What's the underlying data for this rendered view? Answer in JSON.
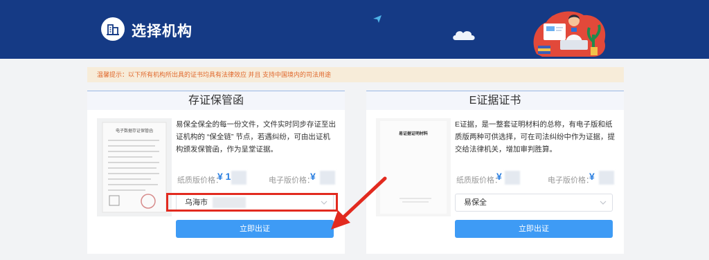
{
  "header": {
    "title": "选择机构",
    "logo_icon": "building-icon"
  },
  "notice": {
    "text": "温馨提示：以下所有机构所出具的证书均具有法律效应 并且 支持中国境内的司法用途"
  },
  "cards": [
    {
      "title": "存证保管函",
      "description": "易保全保全的每一份文件，文件实时同步存证至出证机构的 “保全链” 节点，若遇纠纷，可由出证机构颁发保管函，作为呈堂证据。",
      "image_caption": "电子数据存证保管函",
      "paper_price_label": "纸质版价格：",
      "paper_price_value": "¥ 1",
      "digital_price_label": "电子版价格：",
      "digital_price_value": "¥",
      "select_value": "乌海市",
      "button_label": "立即出证"
    },
    {
      "title": "E证据证书",
      "description": "E证据，是一整套证明材料的总称，有电子版和纸质版两种可供选择，可在司法纠纷中作为证据，提交给法律机关，增加审判胜算。",
      "image_caption": "易证据证明材料",
      "paper_price_label": "纸质版价格：",
      "paper_price_value": "¥",
      "digital_price_label": "电子版价格：",
      "digital_price_value": "¥",
      "select_value": "易保全",
      "button_label": "立即出证"
    }
  ],
  "colors": {
    "header_bg": "#153a85",
    "notice_bg": "#f7ecd9",
    "notice_text": "#e0692d",
    "price": "#2b7fe0",
    "button": "#3e9bf5",
    "highlight": "#e22a1f"
  }
}
